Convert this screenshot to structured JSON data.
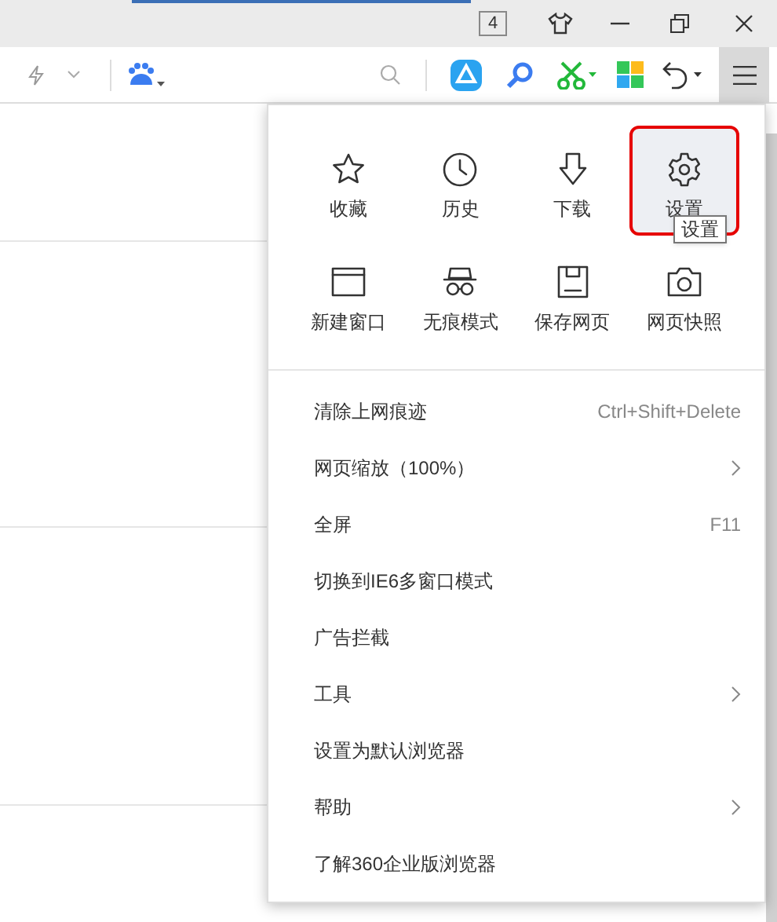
{
  "title_bar": {
    "tab_count": "4"
  },
  "menu": {
    "grid": [
      {
        "label": "收藏",
        "selected": false
      },
      {
        "label": "历史",
        "selected": false
      },
      {
        "label": "下载",
        "selected": false
      },
      {
        "label": "设置",
        "selected": true
      },
      {
        "label": "新建窗口",
        "selected": false
      },
      {
        "label": "无痕模式",
        "selected": false
      },
      {
        "label": "保存网页",
        "selected": false
      },
      {
        "label": "网页快照",
        "selected": false
      }
    ],
    "tooltip": "设置",
    "items": [
      {
        "label": "清除上网痕迹",
        "shortcut": "Ctrl+Shift+Delete",
        "submenu": false
      },
      {
        "label": "网页缩放（100%）",
        "submenu": true
      },
      {
        "label": "全屏",
        "shortcut": "F11",
        "submenu": false
      },
      {
        "label": "切换到IE6多窗口模式",
        "submenu": false
      },
      {
        "label": "广告拦截",
        "submenu": false
      },
      {
        "label": "工具",
        "submenu": true
      },
      {
        "label": "设置为默认浏览器",
        "submenu": false
      },
      {
        "label": "帮助",
        "submenu": true
      },
      {
        "label": "了解360企业版浏览器",
        "submenu": false
      }
    ]
  }
}
